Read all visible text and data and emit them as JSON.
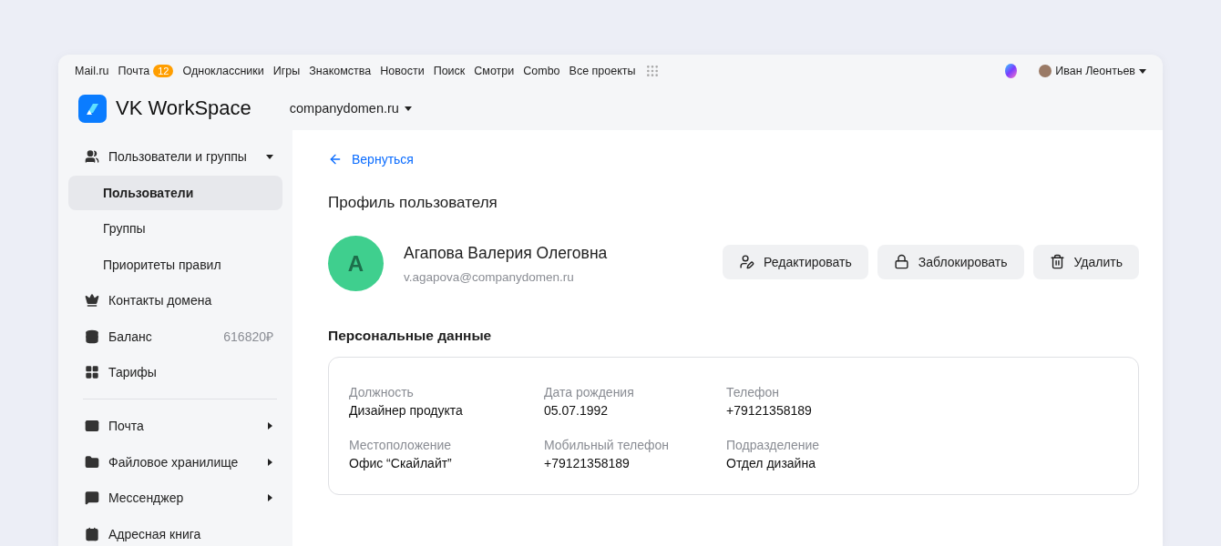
{
  "portal_bar": {
    "links": [
      "Mail.ru",
      "Почта",
      "Одноклассники",
      "Игры",
      "Знакомства",
      "Новости",
      "Поиск",
      "Смотри",
      "Combo",
      "Все проекты"
    ],
    "mail_badge": "12",
    "user": "Иван Леонтьев"
  },
  "header": {
    "logo": "VK WorkSpace",
    "domain": "companydomen.ru"
  },
  "sidebar": {
    "sections": [
      {
        "items": [
          {
            "label": "Пользователи и группы",
            "expanded": true,
            "children": [
              {
                "label": "Пользователи",
                "selected": true
              },
              {
                "label": "Группы",
                "selected": false
              },
              {
                "label": "Приоритеты правил",
                "selected": false
              }
            ]
          },
          {
            "label": "Контакты домена"
          },
          {
            "label": "Баланс",
            "value": "616820₽"
          },
          {
            "label": "Тарифы"
          }
        ]
      },
      {
        "items": [
          {
            "label": "Почта",
            "expanded": false
          },
          {
            "label": "Файловое хранилище",
            "expanded": false
          },
          {
            "label": "Мессенджер",
            "expanded": false
          },
          {
            "label": "Адресная книга"
          }
        ]
      }
    ]
  },
  "content": {
    "back_link": "Вернуться",
    "title": "Профиль пользователя",
    "user": {
      "initial": "А",
      "name": "Агапова Валерия Олеговна",
      "email": "v.agapova@companydomen.ru"
    },
    "actions": [
      "Редактировать",
      "Заблокировать",
      "Удалить"
    ],
    "section_title": "Персональные данные",
    "fields": [
      {
        "label": "Должность",
        "value": "Дизайнер продукта"
      },
      {
        "label": "Дата рождения",
        "value": "05.07.1992"
      },
      {
        "label": "Телефон",
        "value": "+79121358189"
      },
      {
        "label": "Местоположение",
        "value": "Офис “Скайлайт”"
      },
      {
        "label": "Мобильный телефон",
        "value": "+79121358189"
      },
      {
        "label": "Подразделение",
        "value": "Отдел дизайна"
      }
    ]
  }
}
